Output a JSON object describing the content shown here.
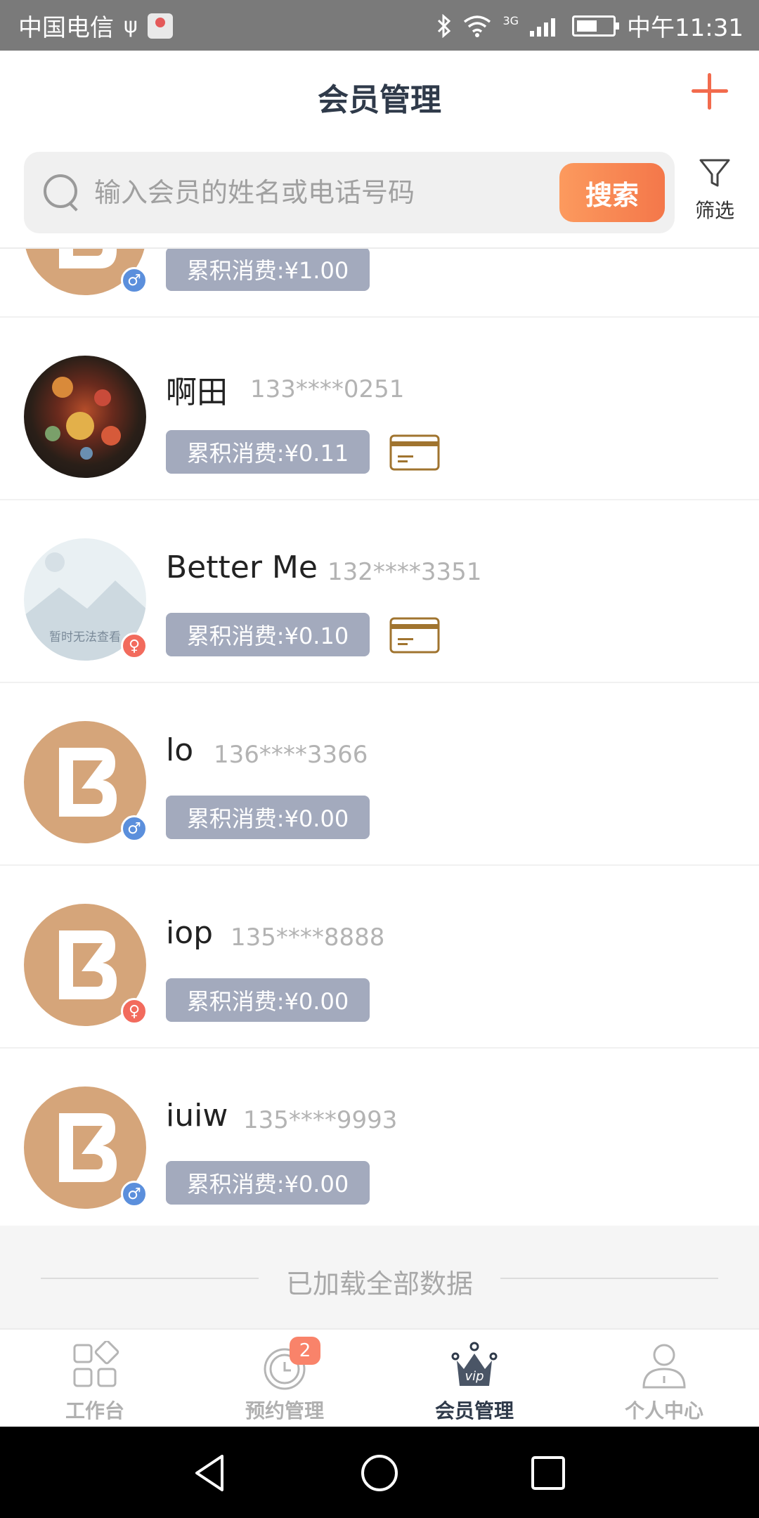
{
  "status_bar": {
    "carrier": "中国电信",
    "network_type": "3G",
    "time": "中午11:31"
  },
  "header": {
    "title": "会员管理",
    "add_icon": "plus-icon"
  },
  "search": {
    "placeholder": "输入会员的姓名或电话号码",
    "button_label": "搜索",
    "filter_label": "筛选"
  },
  "members": [
    {
      "name": "",
      "phone": "",
      "spend": "累积消费:¥1.00",
      "gender": "male",
      "avatar": "default-logo",
      "has_card": false
    },
    {
      "name": "啊田",
      "phone": "133****0251",
      "spend": "累积消费:¥0.11",
      "gender": "",
      "avatar": "photo",
      "has_card": true
    },
    {
      "name": "Better Me",
      "phone": "132****3351",
      "spend": "累积消费:¥0.10",
      "gender": "female",
      "avatar": "placeholder",
      "avatar_text": "暂时无法查看",
      "has_card": true
    },
    {
      "name": "lo",
      "phone": "136****3366",
      "spend": "累积消费:¥0.00",
      "gender": "male",
      "avatar": "default-logo",
      "has_card": false
    },
    {
      "name": "iop",
      "phone": "135****8888",
      "spend": "累积消费:¥0.00",
      "gender": "female",
      "avatar": "default-logo",
      "has_card": false
    },
    {
      "name": "iuiw",
      "phone": "135****9993",
      "spend": "累积消费:¥0.00",
      "gender": "male",
      "avatar": "default-logo",
      "has_card": false
    }
  ],
  "list_end_text": "已加载全部数据",
  "tabs": [
    {
      "label": "工作台",
      "icon": "grid-icon",
      "active": false
    },
    {
      "label": "预约管理",
      "icon": "clock-icon",
      "badge": "2",
      "active": false
    },
    {
      "label": "会员管理",
      "icon": "vip-crown-icon",
      "active": true
    },
    {
      "label": "个人中心",
      "icon": "person-icon",
      "active": false
    }
  ],
  "colors": {
    "accent": "#f4774a",
    "spend_badge": "#a3aabd",
    "logo_avatar": "#d5a57a",
    "male": "#5b8fdc",
    "female": "#f26b5d",
    "card_icon": "#a0742f"
  }
}
